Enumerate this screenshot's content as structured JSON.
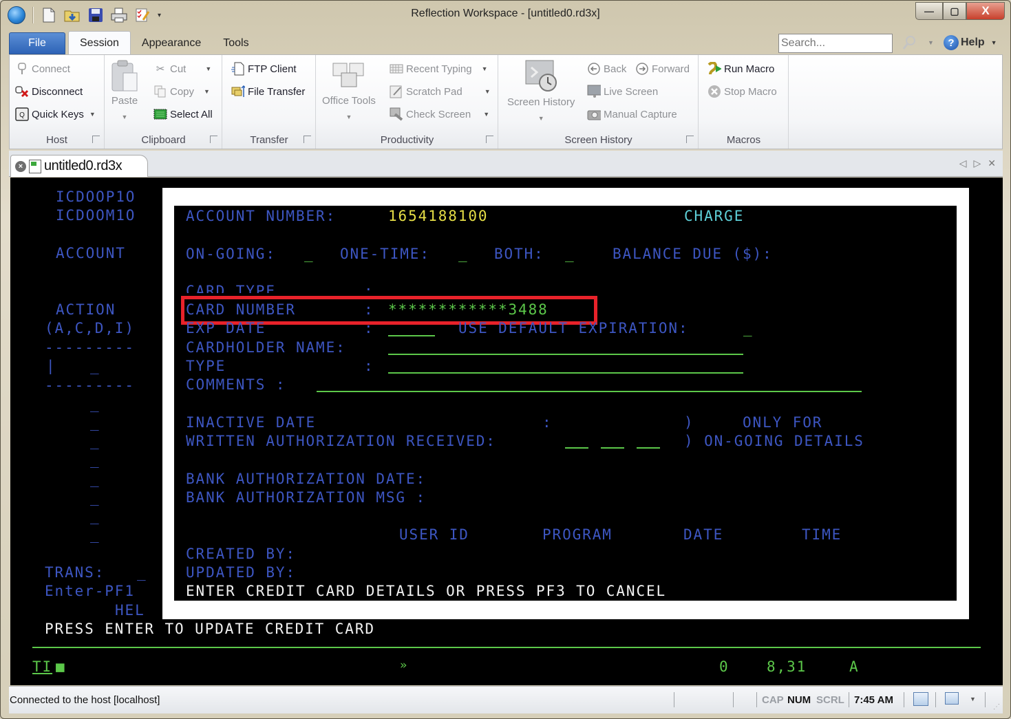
{
  "window": {
    "title": "Reflection Workspace - [untitled0.rd3x]",
    "controls": {
      "minimize": "—",
      "maximize": "▢",
      "close": "X"
    }
  },
  "quick_access": {
    "icons": [
      "app-orb-icon",
      "new-document-icon",
      "open-folder-icon",
      "save-icon",
      "print-icon",
      "edit-checklist-icon"
    ],
    "more": "▾"
  },
  "ribbon_tabs": [
    {
      "label": "File"
    },
    {
      "label": "Session",
      "active": true
    },
    {
      "label": "Appearance"
    },
    {
      "label": "Tools"
    }
  ],
  "search": {
    "placeholder": "Search..."
  },
  "help": {
    "label": "Help",
    "icon": "?"
  },
  "ribbon": {
    "host": {
      "label": "Host",
      "connect": "Connect",
      "disconnect": "Disconnect",
      "quick_keys": "Quick Keys"
    },
    "clipboard": {
      "label": "Clipboard",
      "paste": "Paste",
      "cut": "Cut",
      "copy": "Copy",
      "select_all": "Select All"
    },
    "transfer": {
      "label": "Transfer",
      "ftp_client": "FTP Client",
      "file_transfer": "File Transfer"
    },
    "productivity": {
      "label": "Productivity",
      "office_tools": "Office Tools",
      "recent_typing": "Recent Typing",
      "scratch_pad": "Scratch Pad",
      "check_screen": "Check Screen"
    },
    "screen_history": {
      "label": "Screen History",
      "screen_history": "Screen History",
      "back": "Back",
      "forward": "Forward",
      "live_screen": "Live Screen",
      "manual_capture": "Manual Capture"
    },
    "macros": {
      "label": "Macros",
      "run_macro": "Run Macro",
      "stop_macro": "Stop Macro"
    }
  },
  "doc_tab": {
    "title": "untitled0.rd3x",
    "nav_prev": "◁",
    "nav_next": "▷",
    "nav_close": "✕"
  },
  "terminal": {
    "left": {
      "program1": "ICDOOP1O",
      "program2": "ICDOOM1O",
      "account": "ACCOUNT",
      "action": "ACTION",
      "action_codes": "(A,C,D,I)",
      "dashes": "---------",
      "cursor_bar": "|",
      "field": "_",
      "trans": "TRANS:",
      "trans_field": "_",
      "enter_pf1": "Enter-PF1",
      "hel": "HEL"
    },
    "popup": {
      "account_number_label": "ACCOUNT NUMBER:",
      "account_number_value": "1654188100",
      "mode": "CHARGE",
      "ongoing_label": "ON-GOING:",
      "onetime_label": "ONE-TIME:",
      "both_label": "BOTH:",
      "field": "_",
      "balance_due_label": "BALANCE DUE ($):",
      "card_type_label": "CARD TYPE",
      "colon": ":",
      "card_number_label": "CARD NUMBER",
      "card_number_value": "************3488",
      "exp_date_label": "EXP DATE",
      "use_default_label": "USE DEFAULT EXPIRATION:",
      "cardholder_label": "CARDHOLDER NAME:",
      "type_label": "TYPE",
      "comments_label": "COMMENTS :",
      "inactive_label": "INACTIVE DATE",
      "paren": ")",
      "only_for": "ONLY FOR",
      "written_auth_label": "WRITTEN AUTHORIZATION RECEIVED:",
      "ongoing_details": ") ON-GOING DETAILS",
      "bank_auth_date_label": "BANK AUTHORIZATION DATE:",
      "bank_auth_msg_label": "BANK AUTHORIZATION MSG :",
      "col_user_id": "USER ID",
      "col_program": "PROGRAM",
      "col_date": "DATE",
      "col_time": "TIME",
      "created_by": "CREATED BY:",
      "updated_by": "UPDATED BY:",
      "message": "ENTER CREDIT CARD DETAILS OR PRESS PF3 TO CANCEL"
    },
    "bottom_message": "PRESS ENTER TO UPDATE CREDIT CARD",
    "oia": {
      "indicator": "TI",
      "cursor_block": "■",
      "arrow": "»",
      "zero": "0",
      "position": "8,31",
      "mode": "A"
    }
  },
  "statusbar": {
    "text": "Connected to the host [localhost]",
    "cap": "CAP",
    "num": "NUM",
    "scrl": "SCRL",
    "time": "7:45 AM"
  },
  "colors": {
    "terminal_bg": "#000000",
    "field_label": "#3d56c2",
    "input_value": "#5cc84a",
    "account_value": "#e6de46",
    "mode_text": "#5ed0d8",
    "highlight_box": "#e8222a",
    "file_tab": "#2d63b6"
  }
}
